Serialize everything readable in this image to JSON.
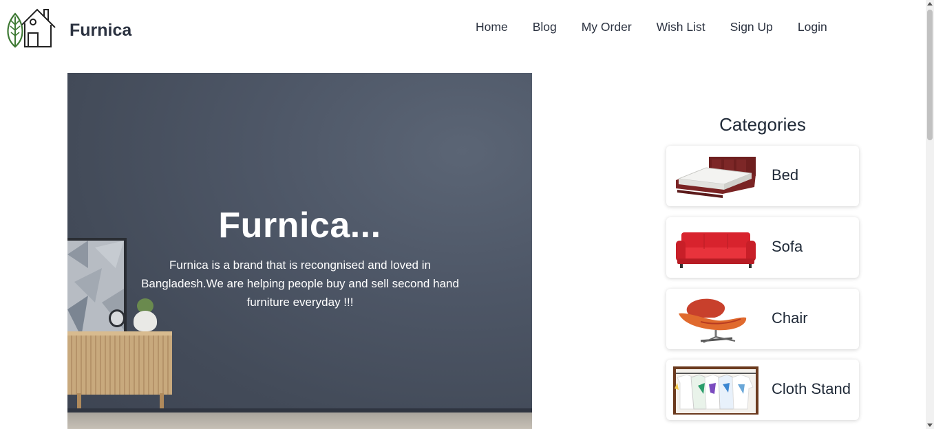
{
  "header": {
    "brand": "Furnica",
    "logo_icon": "leaf-house-icon",
    "nav": [
      "Home",
      "Blog",
      "My Order",
      "Wish List",
      "Sign Up",
      "Login"
    ]
  },
  "hero": {
    "title": "Furnica...",
    "description": "Furnica is a brand that is recongnised and loved in Bangladesh.We are helping people buy and sell second hand furniture everyday !!!"
  },
  "categories": {
    "title": "Categories",
    "items": [
      {
        "label": "Bed",
        "icon": "bed-image"
      },
      {
        "label": "Sofa",
        "icon": "sofa-image"
      },
      {
        "label": "Chair",
        "icon": "chair-image"
      },
      {
        "label": "Cloth Stand",
        "icon": "cloth-stand-image"
      }
    ]
  },
  "colors": {
    "text": "#2b3240",
    "hero_bg": "#4a5363",
    "brand_green": "#3f7a35"
  }
}
